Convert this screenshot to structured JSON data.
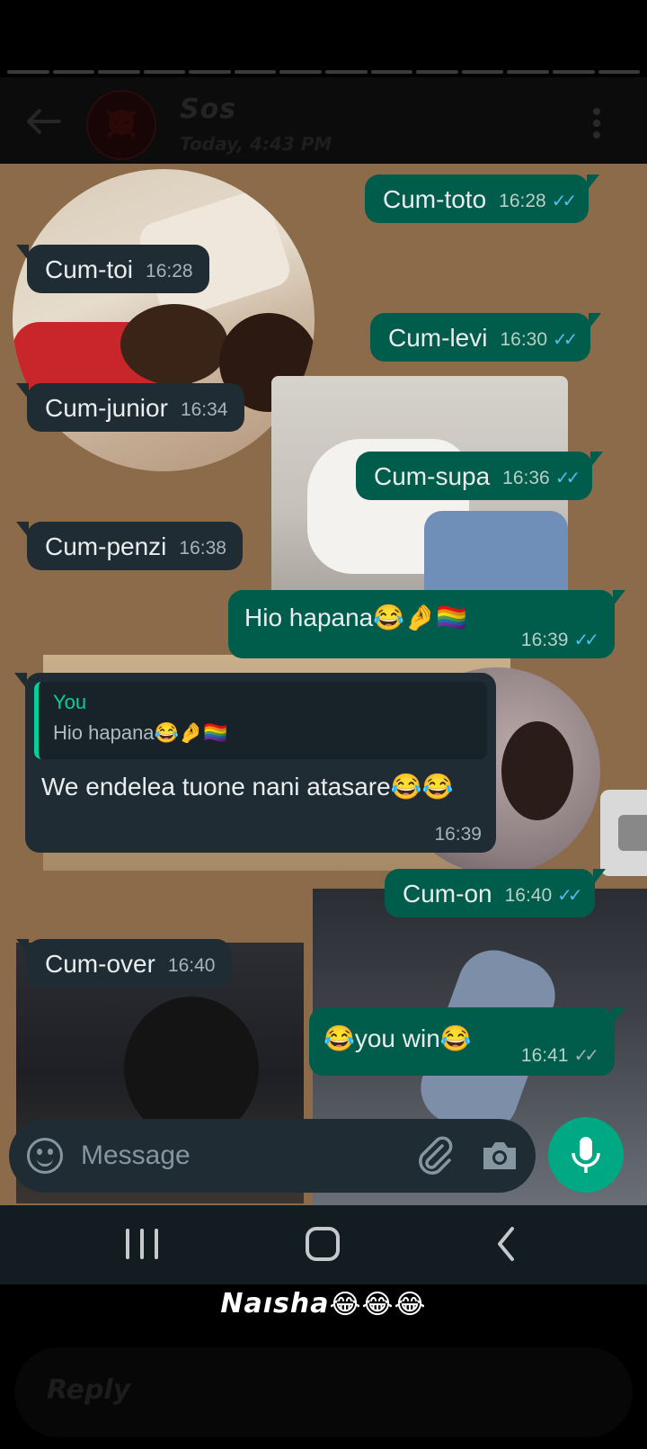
{
  "story": {
    "segments": 14
  },
  "header": {
    "contact_name": "Sos",
    "status": "Today, 4:43 PM"
  },
  "messages": [
    {
      "dir": "out",
      "text": "Cum-toto",
      "time": "16:28",
      "read": true
    },
    {
      "dir": "in",
      "text": "Cum-toi",
      "time": "16:28"
    },
    {
      "dir": "out",
      "text": "Cum-levi",
      "time": "16:30",
      "read": true
    },
    {
      "dir": "in",
      "text": "Cum-junior",
      "time": "16:34"
    },
    {
      "dir": "out",
      "text": "Cum-supa",
      "time": "16:36",
      "read": true
    },
    {
      "dir": "in",
      "text": "Cum-penzi",
      "time": "16:38"
    },
    {
      "dir": "out",
      "text": "Hio hapana😂🤌🏳️‍🌈",
      "time": "16:39",
      "read": true
    },
    {
      "dir": "in",
      "quote_author": "You",
      "quote_text": "Hio hapana😂🤌🏳️‍🌈",
      "text": "We endelea tuone nani atasare😂😂",
      "time": "16:39"
    },
    {
      "dir": "out",
      "text": "Cum-on",
      "time": "16:40",
      "read": true
    },
    {
      "dir": "in",
      "text": "Cum-over",
      "time": "16:40"
    },
    {
      "dir": "out",
      "text": "😂you win😂",
      "time": "16:41",
      "read": false
    }
  ],
  "input": {
    "placeholder": "Message"
  },
  "icons": {
    "back": "arrow-left-icon",
    "menu": "more-vertical-icon",
    "emoji": "emoji-icon",
    "attach": "paperclip-icon",
    "camera": "camera-icon",
    "mic": "mic-icon"
  },
  "colors": {
    "outgoing_bubble": "#005c4b",
    "incoming_bubble": "#1f2c34",
    "read_ticks": "#53bdeb",
    "accent": "#00a884",
    "wallpaper": "#8c6b4a"
  },
  "caption": {
    "text": "Naısha",
    "emoji": "😂😂😂"
  },
  "story_reply": {
    "label": "Reply"
  }
}
